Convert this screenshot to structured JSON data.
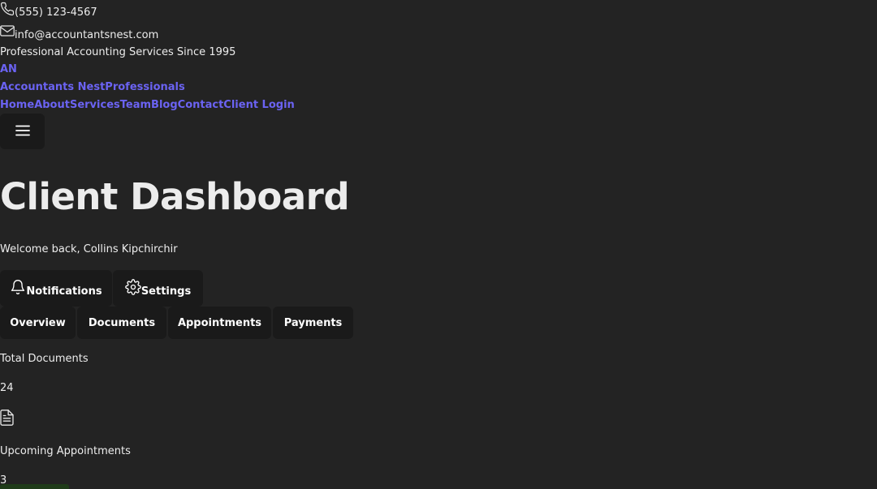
{
  "topbar": {
    "phone": "(555) 123-4567",
    "email": "info@accountantsnest.com",
    "tagline": "Professional Accounting Services Since 1995"
  },
  "brand": {
    "logo_text": "AN",
    "name": "Accountants Nest",
    "subtitle": "Professionals"
  },
  "nav": {
    "items": [
      "Home",
      "About",
      "Services",
      "Team",
      "Blog",
      "Contact",
      "Client Login"
    ]
  },
  "header": {
    "title": "Client Dashboard",
    "welcome": "Welcome back, Collins Kipchirchir"
  },
  "actions": {
    "notifications_label": "Notifications",
    "settings_label": "Settings"
  },
  "tabs": [
    "Overview",
    "Documents",
    "Appointments",
    "Payments"
  ],
  "stats": {
    "documents_label": "Total Documents",
    "documents_value": "24",
    "appointments_label": "Upcoming Appointments",
    "appointments_value": "3"
  },
  "colors": {
    "background": "#232323",
    "accent": "#6b63f3",
    "button_bg": "#1a1a1a"
  }
}
